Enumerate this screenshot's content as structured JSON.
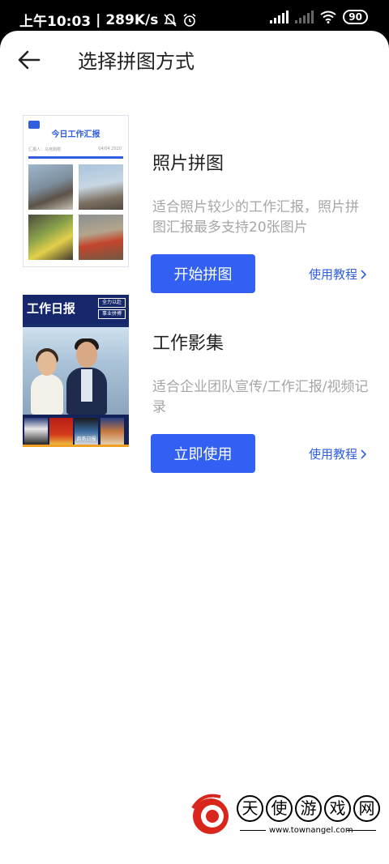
{
  "status_bar": {
    "time": "上午10:03",
    "separator": "|",
    "network_speed": "289K/s",
    "battery": "90"
  },
  "header": {
    "title": "选择拼图方式"
  },
  "cards": [
    {
      "title": "照片拼图",
      "description": "适合照片较少的工作汇报，照片拼图汇报最多支持20张图片",
      "button": "开始拼图",
      "tutorial": "使用教程",
      "thumbnail": {
        "title": "今日工作汇报",
        "reporter": "汇报人：马克刚刚",
        "date": "04/04 2020"
      }
    },
    {
      "title": "工作影集",
      "description": "适合企业团队宣传/工作汇报/视频记录",
      "button": "立即使用",
      "tutorial": "使用教程",
      "thumbnail": {
        "title": "工作日报",
        "tag1": "全力以赴",
        "tag2": "事业拼搏",
        "mini_labels": [
          "",
          "",
          "商务日报",
          ""
        ]
      }
    }
  ],
  "watermark": {
    "chars": [
      "天",
      "使",
      "游",
      "戏",
      "网"
    ],
    "url": "www.townangel.com"
  },
  "colors": {
    "accent": "#3160f2",
    "link": "#2f5fe0",
    "muted_text": "#a6a6a6"
  }
}
